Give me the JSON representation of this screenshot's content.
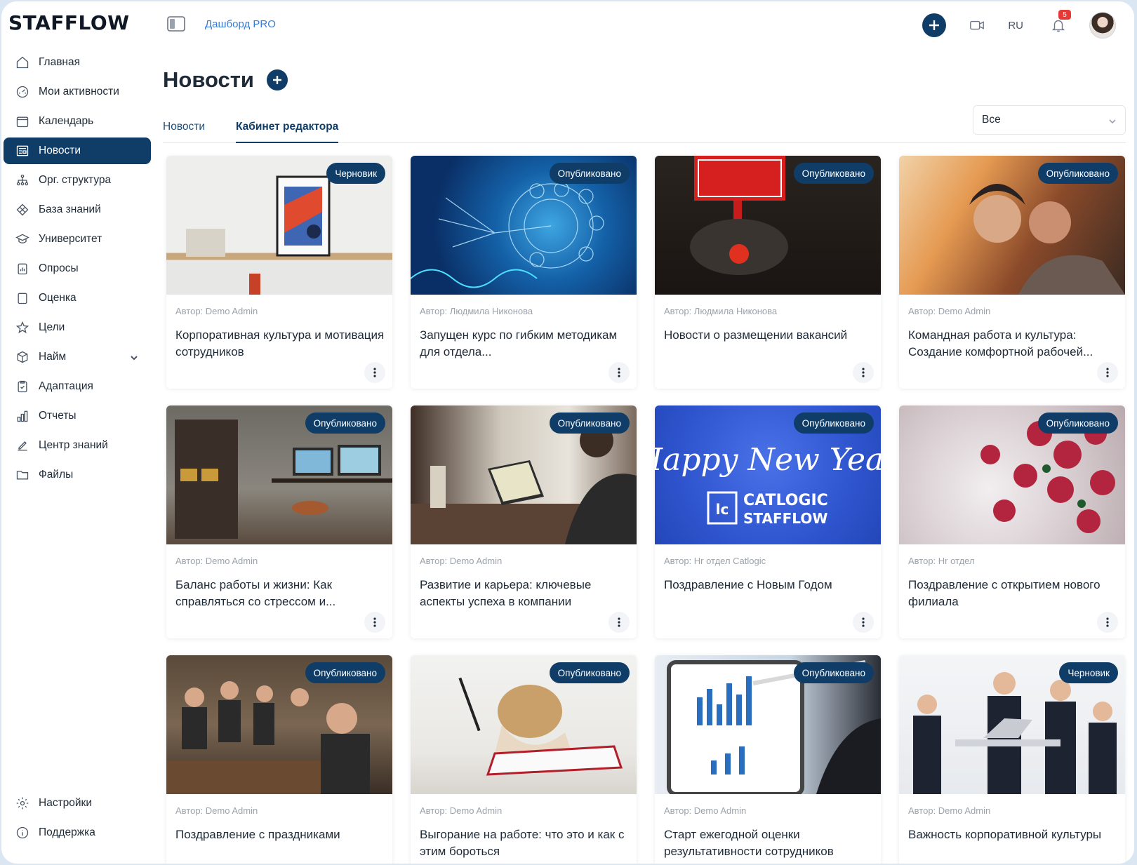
{
  "app": {
    "logo": "STAFFLOW",
    "breadcrumb": "Дашборд PRO"
  },
  "sidebar": {
    "items": [
      {
        "label": "Главная",
        "icon": "home-icon"
      },
      {
        "label": "Мои активности",
        "icon": "gauge-icon"
      },
      {
        "label": "Календарь",
        "icon": "calendar-icon"
      },
      {
        "label": "Новости",
        "icon": "newspaper-icon",
        "active": true
      },
      {
        "label": "Орг. структура",
        "icon": "org-structure-icon"
      },
      {
        "label": "База знаний",
        "icon": "diamond-icon"
      },
      {
        "label": "Университет",
        "icon": "graduation-cap-icon"
      },
      {
        "label": "Опросы",
        "icon": "survey-icon"
      },
      {
        "label": "Оценка",
        "icon": "square-icon"
      },
      {
        "label": "Цели",
        "icon": "star-icon"
      },
      {
        "label": "Найм",
        "icon": "box-icon",
        "expandable": true
      },
      {
        "label": "Адаптация",
        "icon": "clipboard-icon"
      },
      {
        "label": "Отчеты",
        "icon": "bar-chart-icon"
      },
      {
        "label": "Центр знаний",
        "icon": "edit-icon"
      },
      {
        "label": "Файлы",
        "icon": "folder-icon"
      }
    ],
    "bottom": [
      {
        "label": "Настройки",
        "icon": "gear-icon"
      },
      {
        "label": "Поддержка",
        "icon": "info-icon"
      }
    ]
  },
  "header": {
    "lang": "RU",
    "notifications": "5"
  },
  "main": {
    "title": "Новости",
    "tabs": [
      "Новости",
      "Кабинет редактора"
    ],
    "active_tab": "Кабинет редактора",
    "filter": {
      "value": "Все"
    }
  },
  "cards": [
    {
      "status": "Черновик",
      "author": "Автор: Demo Admin",
      "title": "Корпоративная культура и мотивация сотрудников"
    },
    {
      "status": "Опубликовано",
      "author": "Автор: Людмила Никонова",
      "title": "Запущен курс по гибким методикам для отдела..."
    },
    {
      "status": "Опубликовано",
      "author": "Автор: Людмила Никонова",
      "title": "Новости о размещении вакансий"
    },
    {
      "status": "Опубликовано",
      "author": "Автор: Demo Admin",
      "title": "Командная работа и культура: Создание комфортной рабочей..."
    },
    {
      "status": "Опубликовано",
      "author": "Автор: Demo Admin",
      "title": "Баланс работы и жизни: Как справляться со стрессом и..."
    },
    {
      "status": "Опубликовано",
      "author": "Автор: Demo Admin",
      "title": "Развитие и карьера: ключевые аспекты успеха в компании"
    },
    {
      "status": "Опубликовано",
      "author": "Автор: Hr отдел Catlogic",
      "title": "Поздравление с Новым Годом",
      "image_text": [
        "Happy New Year",
        "CATLOGIC",
        "STAFFLOW"
      ]
    },
    {
      "status": "Опубликовано",
      "author": "Автор: Hr отдел",
      "title": "Поздравление с открытием нового филиала"
    },
    {
      "status": "Опубликовано",
      "author": "Автор: Demo Admin",
      "title": "Поздравление с праздниками"
    },
    {
      "status": "Опубликовано",
      "author": "Автор: Demo Admin",
      "title": "Выгорание на работе: что это и как с этим бороться"
    },
    {
      "status": "Опубликовано",
      "author": "Автор: Demo Admin",
      "title": "Старт ежегодной оценки результативности сотрудников"
    },
    {
      "status": "Черновик",
      "author": "Автор: Demo Admin",
      "title": "Важность корпоративной культуры"
    }
  ],
  "colors": {
    "accent": "#0f3d67",
    "link": "#3a7bd5",
    "badge": "#e53935"
  }
}
